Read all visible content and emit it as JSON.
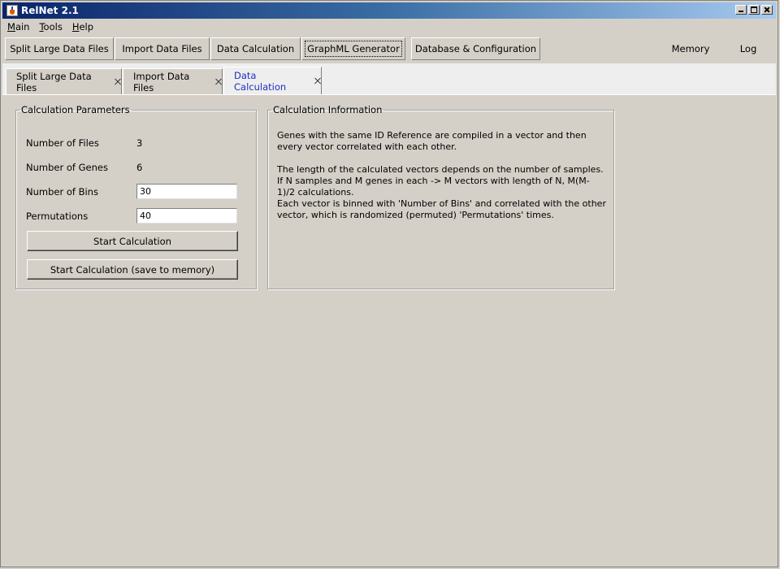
{
  "window": {
    "title": "RelNet 2.1"
  },
  "menu": [
    {
      "first": "M",
      "rest": "ain"
    },
    {
      "first": "T",
      "rest": "ools"
    },
    {
      "first": "H",
      "rest": "elp"
    }
  ],
  "toolbar": {
    "split": "Split Large Data Files",
    "import": "Import Data Files",
    "calc": "Data Calculation",
    "graphml": "GraphML Generator",
    "db": "Database & Configuration",
    "memory": "Memory",
    "log": "Log"
  },
  "tabs": [
    {
      "label": "Split Large Data Files"
    },
    {
      "label": "Import Data Files"
    },
    {
      "label": "Data Calculation"
    }
  ],
  "params": {
    "legend": "Calculation Parameters",
    "files_label": "Number of Files",
    "files_value": "3",
    "genes_label": "Number of Genes",
    "genes_value": "6",
    "bins_label": "Number of Bins",
    "bins_value": "30",
    "perm_label": "Permutations",
    "perm_value": "40",
    "start_button": "Start Calculation",
    "start_memory_button": "Start Calculation (save to memory)"
  },
  "info": {
    "legend": "Calculation Information",
    "paragraphs": [
      "Genes with the same ID Reference are compiled in a vector and then every vector correlated with each other.",
      "The length of the calculated vectors depends on the number of samples. If N samples and M genes in each -> M vectors with length of N, M(M-1)/2 calculations.",
      "Each vector is binned with 'Number of Bins' and correlated with the other vector, which is randomized (permuted) 'Permutations' times."
    ]
  }
}
